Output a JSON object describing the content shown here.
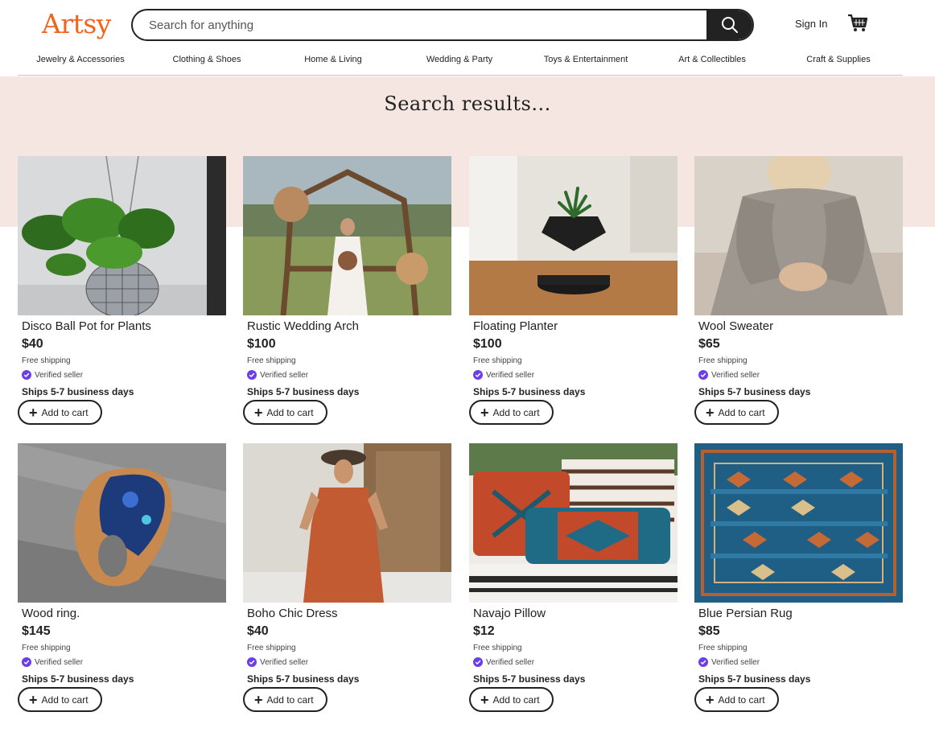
{
  "header": {
    "logo": "Artsy",
    "search_placeholder": "Search for anything",
    "sign_in": "Sign In"
  },
  "nav": [
    "Jewelry & Accessories",
    "Clothing & Shoes",
    "Home & Living",
    "Wedding & Party",
    "Toys & Entertainment",
    "Art & Collectibles",
    "Craft & Supplies"
  ],
  "hero": {
    "title": "Search results..."
  },
  "products": [
    {
      "title": "Disco Ball Pot for Plants",
      "price": "$40",
      "shipping": "Free shipping",
      "verified": "Verified seller",
      "ships": "Ships 5-7 business days",
      "button": "Add to cart"
    },
    {
      "title": "Rustic Wedding Arch",
      "price": "$100",
      "shipping": "Free shipping",
      "verified": "Verified seller",
      "ships": "Ships 5-7 business days",
      "button": "Add to cart"
    },
    {
      "title": "Floating Planter",
      "price": "$100",
      "shipping": "Free shipping",
      "verified": "Verified seller",
      "ships": "Ships 5-7 business days",
      "button": "Add to cart"
    },
    {
      "title": "Wool Sweater",
      "price": "$65",
      "shipping": "Free shipping",
      "verified": "Verified seller",
      "ships": "Ships 5-7 business days",
      "button": "Add to cart"
    },
    {
      "title": "Wood ring.",
      "price": "$145",
      "shipping": "Free shipping",
      "verified": "Verified seller",
      "ships": "Ships 5-7 business days",
      "button": "Add to cart"
    },
    {
      "title": "Boho Chic Dress",
      "price": "$40",
      "shipping": "Free shipping",
      "verified": "Verified seller",
      "ships": "Ships 5-7 business days",
      "button": "Add to cart"
    },
    {
      "title": "Navajo Pillow",
      "price": "$12",
      "shipping": "Free shipping",
      "verified": "Verified seller",
      "ships": "Ships 5-7 business days",
      "button": "Add to cart"
    },
    {
      "title": "Blue Persian Rug",
      "price": "$85",
      "shipping": "Free shipping",
      "verified": "Verified seller",
      "ships": "Ships 5-7 business days",
      "button": "Add to cart"
    }
  ],
  "icons": {
    "search": "search-icon",
    "cart": "shopping-cart-icon",
    "verified": "verified-badge-icon",
    "add": "plus-icon"
  },
  "colors": {
    "brand": "#f1641e",
    "hero_bg": "#f5e6e2",
    "verified": "#6a3ee8"
  }
}
